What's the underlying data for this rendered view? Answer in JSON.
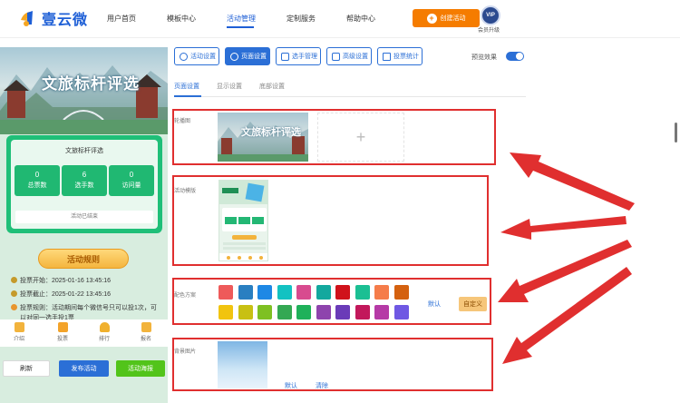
{
  "brand": {
    "name": "壹云微"
  },
  "nav": {
    "items": [
      "用户首页",
      "模板中心",
      "活动管理",
      "定制服务",
      "帮助中心"
    ],
    "create_label": "创建活动",
    "vip_badge": "VIP",
    "vip_label": "会员升级"
  },
  "preview": {
    "banner_title": "文旅标杆评选",
    "card_title": "文旅标杆评选",
    "stats": [
      {
        "value": "0",
        "label": "总票数"
      },
      {
        "value": "6",
        "label": "选手数"
      },
      {
        "value": "0",
        "label": "访问量"
      }
    ],
    "ended": "活动已结束",
    "rules_title": "活动规则",
    "rules": [
      "投票开始：2025-01-16 13:45:16",
      "投票截止：2025-01-22 13:45:16",
      "投票规则：活动期间每个微信号只可以投1次，可",
      "以对同一选手投1票"
    ],
    "tabs": [
      "介绍",
      "投票",
      "排行",
      "报名"
    ],
    "buttons": {
      "refresh": "刷新",
      "publish": "发布活动",
      "poster": "活动海报"
    }
  },
  "toolbar": {
    "buttons": [
      "活动设置",
      "页面设置",
      "选手管理",
      "高级设置",
      "投票统计"
    ],
    "active_index": 1,
    "preview_label": "预览效果",
    "preview_on": true
  },
  "subtabs": {
    "items": [
      "页面设置",
      "显示设置",
      "底部设置"
    ],
    "active_index": 0
  },
  "sections": {
    "carousel": "轮播图",
    "carousel_thumb_title": "文旅标杆评选",
    "template": "活动模版",
    "colors": "配色方案",
    "bgimage": "背景图片"
  },
  "palette": {
    "row1": [
      "#ee5a5a",
      "#2a7fc1",
      "#1e88e5",
      "#13c2c2",
      "#d84b8f",
      "#13a89e",
      "#d0121b",
      "#1bbf93",
      "#f57c4a",
      "#d4610f"
    ],
    "row2": [
      "#f1c40f",
      "#c8c013",
      "#7ec022",
      "#34a853",
      "#1fb15a",
      "#8e44ad",
      "#6a3bb8",
      "#c2185b",
      "#b63aa6",
      "#6f58e3"
    ],
    "default_label": "默认",
    "custom_label": "自定义"
  },
  "bg_actions": {
    "default_label": "默认",
    "clear_label": "清除"
  },
  "colors": {
    "accent": "#2b6fd6",
    "brand": "#1e5fd6",
    "orange": "#f57c00",
    "highlight": "#e02f2f",
    "green": "#1fbf78"
  }
}
